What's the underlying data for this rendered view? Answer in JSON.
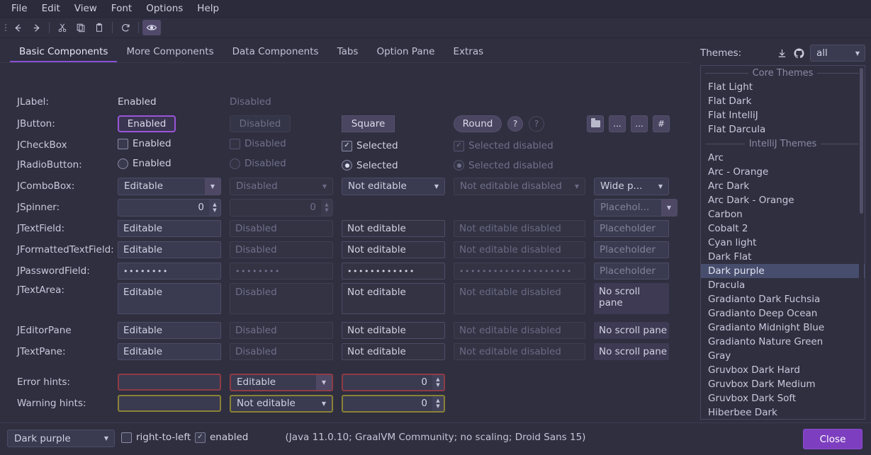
{
  "menubar": [
    "File",
    "Edit",
    "View",
    "Font",
    "Options",
    "Help"
  ],
  "toolbar": {
    "back": "←",
    "forward": "→",
    "cut": "✂",
    "copy": "⧉",
    "paste": "📋",
    "refresh": "⟳",
    "preview": "◉"
  },
  "tabs": [
    {
      "label": "Basic Components",
      "active": true
    },
    {
      "label": "More Components",
      "active": false
    },
    {
      "label": "Data Components",
      "active": false
    },
    {
      "label": "Tabs",
      "active": false
    },
    {
      "label": "Option Pane",
      "active": false
    },
    {
      "label": "Extras",
      "active": false
    }
  ],
  "rows": {
    "jlabel": {
      "label": "JLabel:",
      "enabled": "Enabled",
      "disabled": "Disabled"
    },
    "jbutton": {
      "label": "JButton:",
      "enabled": "Enabled",
      "disabled": "Disabled",
      "square": "Square",
      "round": "Round",
      "help": "?",
      "help_disabled": "?",
      "folder": "",
      "ellipsis1": "...",
      "ellipsis2": "...",
      "hash": "#"
    },
    "jcheckbox": {
      "label": "JCheckBox",
      "enabled": "Enabled",
      "disabled": "Disabled",
      "selected": "Selected",
      "selected_disabled": "Selected disabled",
      "check_glyph": "✓"
    },
    "jradiobutton": {
      "label": "JRadioButton:",
      "enabled": "Enabled",
      "disabled": "Disabled",
      "selected": "Selected",
      "selected_disabled": "Selected disabled"
    },
    "jcombobox": {
      "label": "JComboBox:",
      "editable": "Editable",
      "disabled": "Disabled",
      "not_editable": "Not editable",
      "not_editable_disabled": "Not editable disabled",
      "wide": "Wide p...",
      "arrow": "▼"
    },
    "jspinner": {
      "label": "JSpinner:",
      "value": "0",
      "disabled_value": "0",
      "placeholder": "Placehol...",
      "up": "▲",
      "down": "▼"
    },
    "jtextfield": {
      "label": "JTextField:",
      "editable": "Editable",
      "disabled": "Disabled",
      "not_editable": "Not editable",
      "not_editable_disabled": "Not editable disabled",
      "placeholder": "Placeholder"
    },
    "jformattedtextfield": {
      "label": "JFormattedTextField:",
      "editable": "Editable",
      "disabled": "Disabled",
      "not_editable": "Not editable",
      "not_editable_disabled": "Not editable disabled",
      "placeholder": "Placeholder"
    },
    "jpasswordfield": {
      "label": "JPasswordField:",
      "editable": "••••••••",
      "disabled": "••••••••",
      "not_editable": "••••••••••••",
      "not_editable_disabled": "••••••••••••••••••••",
      "placeholder": "Placeholder"
    },
    "jtextarea": {
      "label": "JTextArea:",
      "editable": "Editable",
      "disabled": "Disabled",
      "not_editable": "Not editable",
      "not_editable_disabled": "Not editable disabled",
      "no_scroll": "No scroll pane"
    },
    "jeditorpane": {
      "label": "JEditorPane",
      "editable": "Editable",
      "disabled": "Disabled",
      "not_editable": "Not editable",
      "not_editable_disabled": "Not editable disabled",
      "no_scroll": "No scroll pane"
    },
    "jtextpane": {
      "label": "JTextPane:",
      "editable": "Editable",
      "disabled": "Disabled",
      "not_editable": "Not editable",
      "not_editable_disabled": "Not editable disabled",
      "no_scroll": "No scroll pane"
    },
    "error_hints": {
      "label": "Error hints:",
      "field": "",
      "combo": "Editable",
      "spinner": "0"
    },
    "warning_hints": {
      "label": "Warning hints:",
      "field": "",
      "combo": "Not editable",
      "spinner": "0"
    }
  },
  "themes": {
    "title": "Themes:",
    "download_icon": "⭳",
    "github_icon": "github-mark",
    "filter": "all",
    "filter_arrow": "▼",
    "groups": [
      {
        "header": "Core Themes",
        "items": [
          "Flat Light",
          "Flat Dark",
          "Flat IntelliJ",
          "Flat Darcula"
        ]
      },
      {
        "header": "IntelliJ Themes",
        "items": [
          "Arc",
          "Arc - Orange",
          "Arc Dark",
          "Arc Dark - Orange",
          "Carbon",
          "Cobalt 2",
          "Cyan light",
          "Dark Flat",
          "Dark purple",
          "Dracula",
          "Gradianto Dark Fuchsia",
          "Gradianto Deep Ocean",
          "Gradianto Midnight Blue",
          "Gradianto Nature Green",
          "Gray",
          "Gruvbox Dark Hard",
          "Gruvbox Dark Medium",
          "Gruvbox Dark Soft",
          "Hiberbee Dark"
        ]
      }
    ],
    "selected": "Dark purple"
  },
  "statusbar": {
    "theme": "Dark purple",
    "theme_arrow": "▼",
    "rtl_label": "right-to-left",
    "enabled_label": "enabled",
    "info": "(Java 11.0.10; GraalVM Community; no scaling; Droid Sans 15)",
    "close": "Close"
  },
  "colors": {
    "accent": "#8a4fd4",
    "close_button": "#7d3fbf",
    "selection": "#474d6d",
    "error": "#8f3c46",
    "warning": "#8a8236"
  }
}
